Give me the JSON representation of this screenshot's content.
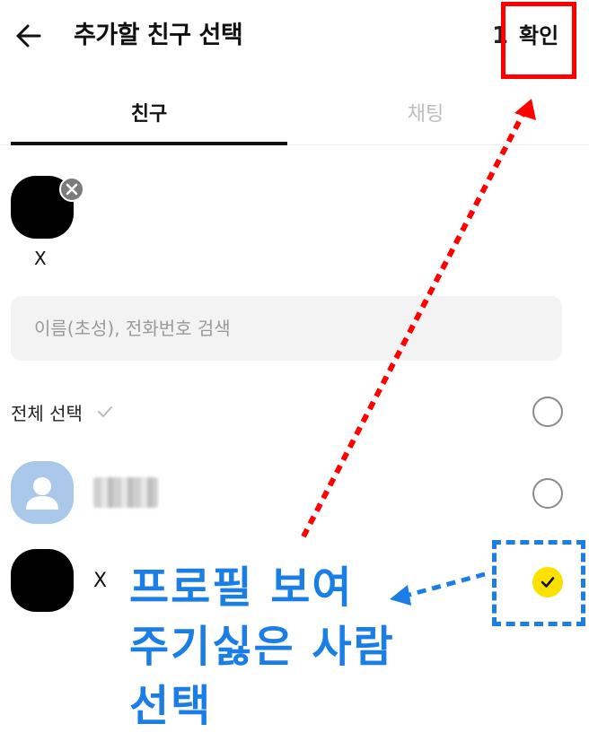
{
  "header": {
    "back_icon": "arrow-left-icon",
    "title": "추가할 친구 선택",
    "count": "1",
    "confirm_label": "확인"
  },
  "tabs": [
    {
      "label": "친구",
      "active": true
    },
    {
      "label": "채팅",
      "active": false
    }
  ],
  "selected_chip": {
    "name": "X",
    "remove_icon": "close-icon"
  },
  "search": {
    "placeholder": "이름(초성), 전화번호 검색",
    "value": ""
  },
  "select_all": {
    "label": "전체 선택",
    "check_icon": "check-icon",
    "checked": false
  },
  "friends": [
    {
      "name": "",
      "name_blurred": true,
      "avatar": "default-person-icon",
      "checked": false
    },
    {
      "name": "X",
      "avatar": "black-avatar",
      "checked": true
    }
  ],
  "annotation": {
    "lines": [
      "프로필 보여",
      "주기싫은 사람",
      "선택"
    ],
    "colors": {
      "red": "#ff0000",
      "blue": "#1a7ee6"
    }
  },
  "colors": {
    "check_yellow": "#fae100",
    "inactive_tab": "#bdbdbd",
    "search_bg": "#f3f3f3"
  }
}
